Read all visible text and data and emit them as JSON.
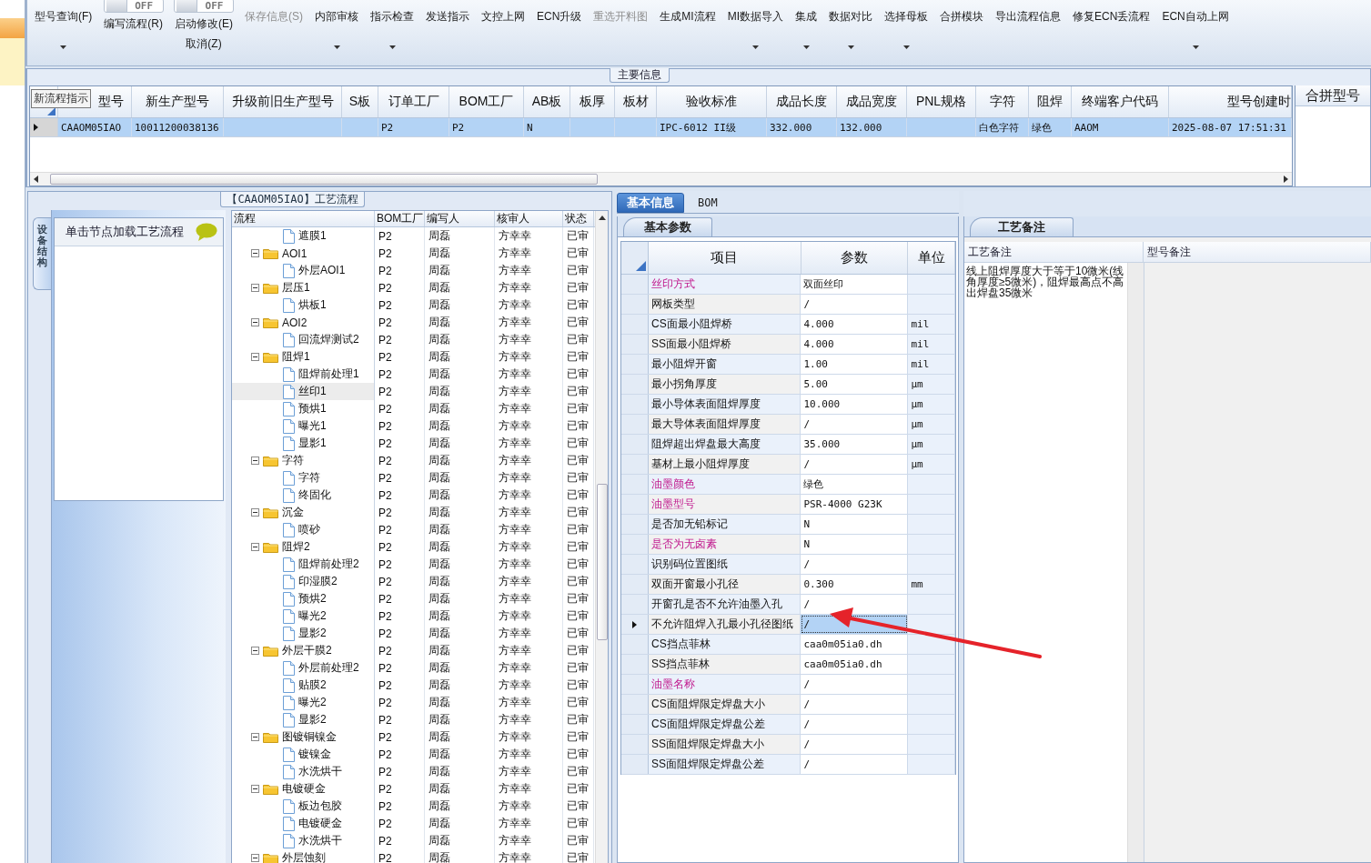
{
  "toolbar": {
    "items": [
      {
        "kind": "button",
        "label": "型号查询(F)",
        "dropdown": true,
        "disabled": false
      },
      {
        "kind": "toggle",
        "state_label": "OFF",
        "on": false,
        "labels": [
          "编写流程(R)"
        ]
      },
      {
        "kind": "toggle",
        "state_label": "OFF",
        "on": false,
        "labels": [
          "启动修改(E)",
          "取消(Z)"
        ]
      },
      {
        "kind": "button",
        "label": "保存信息(S)",
        "dropdown": false,
        "disabled": true
      },
      {
        "kind": "button",
        "label": "内部审核",
        "dropdown": true,
        "disabled": false
      },
      {
        "kind": "button",
        "label": "指示检查",
        "dropdown": true,
        "disabled": false
      },
      {
        "kind": "button",
        "label": "发送指示",
        "dropdown": false,
        "disabled": false
      },
      {
        "kind": "button",
        "label": "文控上网",
        "dropdown": false,
        "disabled": false
      },
      {
        "kind": "button",
        "label": "ECN升级",
        "dropdown": false,
        "disabled": false
      },
      {
        "kind": "button",
        "label": "重选开料图",
        "dropdown": false,
        "disabled": true
      },
      {
        "kind": "button",
        "label": "生成MI流程",
        "dropdown": false,
        "disabled": false
      },
      {
        "kind": "button",
        "label": "MI数据导入",
        "dropdown": true,
        "disabled": false
      },
      {
        "kind": "button",
        "label": "集成",
        "dropdown": true,
        "disabled": false
      },
      {
        "kind": "button",
        "label": "数据对比",
        "dropdown": true,
        "disabled": false
      },
      {
        "kind": "button",
        "label": "选择母板",
        "dropdown": true,
        "disabled": false
      },
      {
        "kind": "button",
        "label": "合拼模块",
        "dropdown": false,
        "disabled": false
      },
      {
        "kind": "button",
        "label": "导出流程信息",
        "dropdown": false,
        "disabled": false
      },
      {
        "kind": "button",
        "label": "修复ECN丢流程",
        "dropdown": false,
        "disabled": false
      },
      {
        "kind": "button",
        "label": "ECN自动上网",
        "dropdown": true,
        "disabled": false
      }
    ]
  },
  "main_info": {
    "title": "主要信息",
    "tooltip": "新流程指示",
    "columns": [
      "型号",
      "新生产型号",
      "升级前旧生产型号",
      "S板",
      "订单工厂",
      "BOM工厂",
      "AB板",
      "板厚",
      "板材",
      "验收标准",
      "成品长度",
      "成品宽度",
      "PNL规格",
      "字符",
      "阻焊",
      "终端客户代码",
      "型号创建时"
    ],
    "rows": [
      {
        "selected": true,
        "cells": [
          "CAAOM05IAO",
          "10011200038136",
          null,
          null,
          "P2",
          "P2",
          "N",
          null,
          null,
          "IPC-6012 II级",
          "332.000",
          "132.000",
          null,
          "白色字符",
          "绿色",
          "AAOM",
          "2025-08-07 17:51:31"
        ]
      }
    ],
    "side_column": "合拼型号"
  },
  "flow": {
    "title": "【CAAOM05IAO】工艺流程",
    "side_tab": "设备结构",
    "hint": "单击节点加载工艺流程",
    "columns": [
      "流程",
      "BOM工厂",
      "编写人",
      "核审人",
      "状态"
    ],
    "loose_children": [
      {
        "name": "遮膜1",
        "cells": [
          "P2",
          "周磊",
          "方幸幸",
          "已审"
        ],
        "selected": false
      }
    ],
    "nodes": [
      {
        "name": "AOI1",
        "cells": [
          "P2",
          "周磊",
          "方幸幸",
          "已审"
        ],
        "expanded": true,
        "selected": false,
        "children": [
          {
            "name": "外层AOI1",
            "cells": [
              "P2",
              "周磊",
              "方幸幸",
              "已审"
            ],
            "selected": false
          }
        ]
      },
      {
        "name": "层压1",
        "cells": [
          "P2",
          "周磊",
          "方幸幸",
          "已审"
        ],
        "expanded": true,
        "selected": false,
        "children": [
          {
            "name": "烘板1",
            "cells": [
              "P2",
              "周磊",
              "方幸幸",
              "已审"
            ],
            "selected": false
          }
        ]
      },
      {
        "name": "AOI2",
        "cells": [
          "P2",
          "周磊",
          "方幸幸",
          "已审"
        ],
        "expanded": true,
        "selected": false,
        "children": [
          {
            "name": "回流焊测试2",
            "cells": [
              "P2",
              "周磊",
              "方幸幸",
              "已审"
            ],
            "selected": false
          }
        ]
      },
      {
        "name": "阻焊1",
        "cells": [
          "P2",
          "周磊",
          "方幸幸",
          "已审"
        ],
        "expanded": true,
        "selected": false,
        "children": [
          {
            "name": "阻焊前处理1",
            "cells": [
              "P2",
              "周磊",
              "方幸幸",
              "已审"
            ],
            "selected": false
          },
          {
            "name": "丝印1",
            "cells": [
              "P2",
              "周磊",
              "方幸幸",
              "已审"
            ],
            "selected": true
          },
          {
            "name": "预烘1",
            "cells": [
              "P2",
              "周磊",
              "方幸幸",
              "已审"
            ],
            "selected": false
          },
          {
            "name": "曝光1",
            "cells": [
              "P2",
              "周磊",
              "方幸幸",
              "已审"
            ],
            "selected": false
          },
          {
            "name": "显影1",
            "cells": [
              "P2",
              "周磊",
              "方幸幸",
              "已审"
            ],
            "selected": false
          }
        ]
      },
      {
        "name": "字符",
        "cells": [
          "P2",
          "周磊",
          "方幸幸",
          "已审"
        ],
        "expanded": true,
        "selected": false,
        "children": [
          {
            "name": "字符",
            "cells": [
              "P2",
              "周磊",
              "方幸幸",
              "已审"
            ],
            "selected": false
          },
          {
            "name": "终固化",
            "cells": [
              "P2",
              "周磊",
              "方幸幸",
              "已审"
            ],
            "selected": false
          }
        ]
      },
      {
        "name": "沉金",
        "cells": [
          "P2",
          "周磊",
          "方幸幸",
          "已审"
        ],
        "expanded": true,
        "selected": false,
        "children": [
          {
            "name": "喷砂",
            "cells": [
              "P2",
              "周磊",
              "方幸幸",
              "已审"
            ],
            "selected": false
          }
        ]
      },
      {
        "name": "阻焊2",
        "cells": [
          "P2",
          "周磊",
          "方幸幸",
          "已审"
        ],
        "expanded": true,
        "selected": false,
        "children": [
          {
            "name": "阻焊前处理2",
            "cells": [
              "P2",
              "周磊",
              "方幸幸",
              "已审"
            ],
            "selected": false
          },
          {
            "name": "印湿膜2",
            "cells": [
              "P2",
              "周磊",
              "方幸幸",
              "已审"
            ],
            "selected": false
          },
          {
            "name": "预烘2",
            "cells": [
              "P2",
              "周磊",
              "方幸幸",
              "已审"
            ],
            "selected": false
          },
          {
            "name": "曝光2",
            "cells": [
              "P2",
              "周磊",
              "方幸幸",
              "已审"
            ],
            "selected": false
          },
          {
            "name": "显影2",
            "cells": [
              "P2",
              "周磊",
              "方幸幸",
              "已审"
            ],
            "selected": false
          }
        ]
      },
      {
        "name": "外层干膜2",
        "cells": [
          "P2",
          "周磊",
          "方幸幸",
          "已审"
        ],
        "expanded": true,
        "selected": false,
        "children": [
          {
            "name": "外层前处理2",
            "cells": [
              "P2",
              "周磊",
              "方幸幸",
              "已审"
            ],
            "selected": false
          },
          {
            "name": "贴膜2",
            "cells": [
              "P2",
              "周磊",
              "方幸幸",
              "已审"
            ],
            "selected": false
          },
          {
            "name": "曝光2",
            "cells": [
              "P2",
              "周磊",
              "方幸幸",
              "已审"
            ],
            "selected": false
          },
          {
            "name": "显影2",
            "cells": [
              "P2",
              "周磊",
              "方幸幸",
              "已审"
            ],
            "selected": false
          }
        ]
      },
      {
        "name": "图镀铜镍金",
        "cells": [
          "P2",
          "周磊",
          "方幸幸",
          "已审"
        ],
        "expanded": true,
        "selected": false,
        "children": [
          {
            "name": "镀镍金",
            "cells": [
              "P2",
              "周磊",
              "方幸幸",
              "已审"
            ],
            "selected": false
          },
          {
            "name": "水洗烘干",
            "cells": [
              "P2",
              "周磊",
              "方幸幸",
              "已审"
            ],
            "selected": false
          }
        ]
      },
      {
        "name": "电镀硬金",
        "cells": [
          "P2",
          "周磊",
          "方幸幸",
          "已审"
        ],
        "expanded": true,
        "selected": false,
        "children": [
          {
            "name": "板边包胶",
            "cells": [
              "P2",
              "周磊",
              "方幸幸",
              "已审"
            ],
            "selected": false
          },
          {
            "name": "电镀硬金",
            "cells": [
              "P2",
              "周磊",
              "方幸幸",
              "已审"
            ],
            "selected": false
          },
          {
            "name": "水洗烘干",
            "cells": [
              "P2",
              "周磊",
              "方幸幸",
              "已审"
            ],
            "selected": false
          }
        ]
      },
      {
        "name": "外层蚀刻",
        "cells": [
          "P2",
          "周磊",
          "方幸幸",
          "已审"
        ],
        "expanded": true,
        "selected": false
      }
    ]
  },
  "details": {
    "tabs": [
      {
        "label": "基本信息",
        "selected": true
      },
      {
        "label": "BOM",
        "selected": false
      }
    ],
    "subtab": "基本参数",
    "columns": [
      "项目",
      "参数",
      "单位"
    ],
    "rows": [
      {
        "name": "丝印方式",
        "value": "双面丝印",
        "highlighted": true,
        "selected": false
      },
      {
        "name": "网板类型",
        "value": "/",
        "highlighted": false,
        "selected": false
      },
      {
        "name": "CS面最小阻焊桥",
        "value": "4.000",
        "unit": "mil",
        "highlighted": false,
        "selected": false
      },
      {
        "name": "SS面最小阻焊桥",
        "value": "4.000",
        "unit": "mil",
        "highlighted": false,
        "selected": false
      },
      {
        "name": "最小阻焊开窗",
        "value": "1.00",
        "unit": "mil",
        "highlighted": false,
        "selected": false
      },
      {
        "name": "最小拐角厚度",
        "value": "5.00",
        "unit": "μm",
        "highlighted": false,
        "selected": false
      },
      {
        "name": "最小导体表面阻焊厚度",
        "value": "10.000",
        "unit": "μm",
        "highlighted": false,
        "selected": false
      },
      {
        "name": "最大导体表面阻焊厚度",
        "value": "/",
        "unit": "μm",
        "highlighted": false,
        "selected": false
      },
      {
        "name": "阻焊超出焊盘最大高度",
        "value": "35.000",
        "unit": "μm",
        "highlighted": false,
        "selected": false
      },
      {
        "name": "基材上最小阻焊厚度",
        "value": "/",
        "unit": "μm",
        "highlighted": false,
        "selected": false
      },
      {
        "name": "油墨颜色",
        "value": "绿色",
        "highlighted": true,
        "selected": false
      },
      {
        "name": "油墨型号",
        "value": "PSR-4000 G23K",
        "highlighted": true,
        "selected": false
      },
      {
        "name": "是否加无铅标记",
        "value": "N",
        "highlighted": false,
        "selected": false
      },
      {
        "name": "是否为无卤素",
        "value": "N",
        "highlighted": true,
        "selected": false
      },
      {
        "name": "识别码位置图纸",
        "value": "/",
        "highlighted": false,
        "selected": false
      },
      {
        "name": "双面开窗最小孔径",
        "value": "0.300",
        "unit": "mm",
        "highlighted": false,
        "selected": false
      },
      {
        "name": "开窗孔是否不允许油墨入孔",
        "value": "/",
        "highlighted": false,
        "selected": false
      },
      {
        "name": "不允许阻焊入孔最小孔径图纸",
        "value": "/",
        "highlighted": false,
        "selected": true
      },
      {
        "name": "CS挡点菲林",
        "value": "caa0m05ia0.dh",
        "highlighted": false,
        "selected": false
      },
      {
        "name": "SS挡点菲林",
        "value": "caa0m05ia0.dh",
        "highlighted": false,
        "selected": false
      },
      {
        "name": "油墨名称",
        "value": "/",
        "highlighted": true,
        "selected": false
      },
      {
        "name": "CS面阻焊限定焊盘大小",
        "value": "/",
        "highlighted": false,
        "selected": false
      },
      {
        "name": "CS面阻焊限定焊盘公差",
        "value": "/",
        "highlighted": false,
        "selected": false
      },
      {
        "name": "SS面阻焊限定焊盘大小",
        "value": "/",
        "highlighted": false,
        "selected": false
      },
      {
        "name": "SS面阻焊限定焊盘公差",
        "value": "/",
        "highlighted": false,
        "selected": false
      }
    ]
  },
  "notes": {
    "tab": "工艺备注",
    "columns": [
      "工艺备注",
      "型号备注"
    ],
    "text": "线上阻焊厚度大于等于10微米(线角厚度≥5微米)，阻焊最高点不高出焊盘35微米"
  }
}
